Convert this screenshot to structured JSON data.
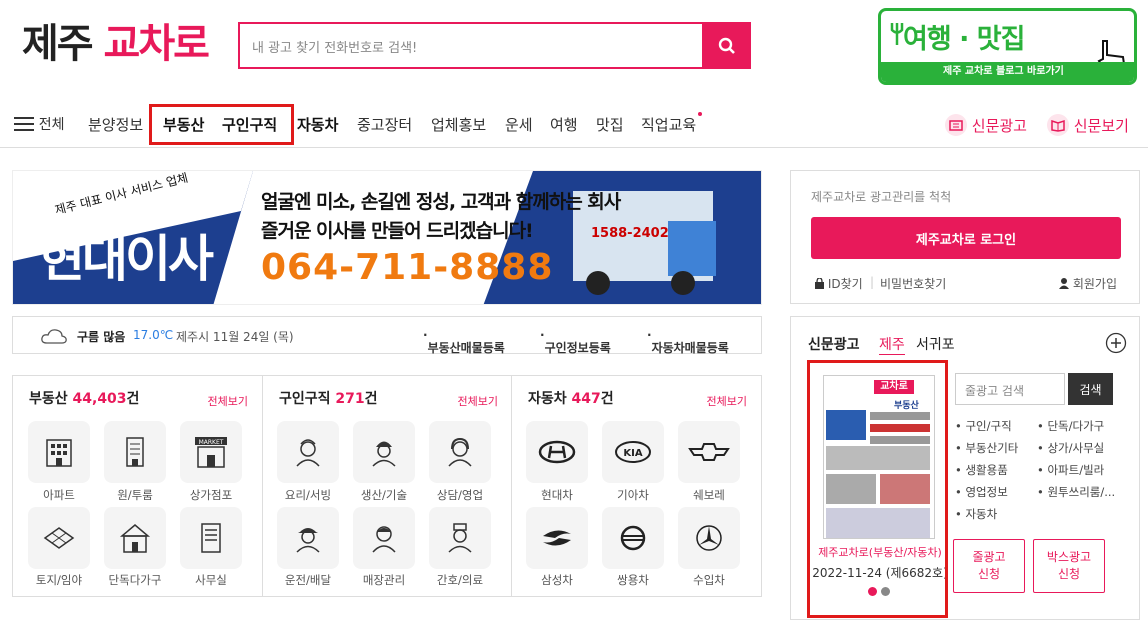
{
  "brand": {
    "logo_prefix": "제주",
    "logo_name": "교차로"
  },
  "search": {
    "placeholder": "내 광고 찾기 전화번호로 검색!"
  },
  "promo": {
    "title": "여행 · 맛집",
    "subtitle": "제주 교차로 블로그 바로가기"
  },
  "nav": {
    "menu_label": "전체",
    "items": [
      "분양정보",
      "부동산",
      "구인구직",
      "자동차",
      "중고장터",
      "업체홍보",
      "운세",
      "여행",
      "맛집",
      "직업교육"
    ],
    "right": [
      "신문광고",
      "신문보기"
    ]
  },
  "ad": {
    "tagline": "제주 대표 이사 서비스 업체",
    "company": "현대이사",
    "line1": "얼굴엔 미소, 손길엔 정성, 고객과 함께하는 회사",
    "line2": "즐거운 이사를 만들어 드리겠습니다!",
    "phone": "064-711-8888",
    "truck_phone": "1588-2402"
  },
  "weather": {
    "condition": "구름 많음",
    "temp": "17.0℃",
    "location": "제주시 11월 24일 (목)",
    "links": [
      "부동산매물등록",
      "구인정보등록",
      "자동차매물등록"
    ]
  },
  "categories": [
    {
      "title": "부동산",
      "count": "44,403",
      "unit": "건",
      "all": "전체보기",
      "items": [
        {
          "label": "아파트",
          "icon": "apartment-icon"
        },
        {
          "label": "원/투룸",
          "icon": "building-icon"
        },
        {
          "label": "상가점포",
          "icon": "market-icon"
        },
        {
          "label": "토지/임야",
          "icon": "land-icon"
        },
        {
          "label": "단독다가구",
          "icon": "house-icon"
        },
        {
          "label": "사무실",
          "icon": "office-icon"
        }
      ]
    },
    {
      "title": "구인구직",
      "count": "271",
      "unit": "건",
      "all": "전체보기",
      "items": [
        {
          "label": "요리/서빙",
          "icon": "cook-icon"
        },
        {
          "label": "생산/기술",
          "icon": "worker-icon"
        },
        {
          "label": "상담/영업",
          "icon": "agent-icon"
        },
        {
          "label": "운전/배달",
          "icon": "driver-icon"
        },
        {
          "label": "매장관리",
          "icon": "clerk-icon"
        },
        {
          "label": "간호/의료",
          "icon": "nurse-icon"
        }
      ]
    },
    {
      "title": "자동차",
      "count": "447",
      "unit": "건",
      "all": "전체보기",
      "items": [
        {
          "label": "현대차",
          "icon": "hyundai-icon"
        },
        {
          "label": "기아차",
          "icon": "kia-icon"
        },
        {
          "label": "쉐보레",
          "icon": "chevrolet-icon"
        },
        {
          "label": "삼성차",
          "icon": "samsung-icon"
        },
        {
          "label": "쌍용차",
          "icon": "ssangyong-icon"
        },
        {
          "label": "수입차",
          "icon": "mercedes-icon"
        }
      ]
    }
  ],
  "login": {
    "caption": "제주교차로 광고관리를 척척",
    "button": "제주교차로 로그인",
    "find_id": "ID찾기",
    "find_pw": "비밀번호찾기",
    "join": "회원가입"
  },
  "paper": {
    "tabs": [
      "신문광고",
      "제주",
      "서귀포"
    ],
    "search_placeholder": "줄광고 검색",
    "search_button": "검색",
    "links_left": [
      "구인/구직",
      "부동산기타",
      "생활용품",
      "영업정보",
      "자동차"
    ],
    "links_right": [
      "단독/다가구",
      "상가/사무실",
      "아파트/빌라",
      "원투쓰리룸/..."
    ],
    "edition_title": "제주교차로(부동산/자동차)",
    "edition_date": "2022-11-24 (제6682호)",
    "btn_line": "줄광고\n신청",
    "btn_box": "박스광고\n신청",
    "thumb_logo": "교차로",
    "thumb_section": "부동산"
  },
  "colors": {
    "accent": "#e8195a",
    "promo": "#2ab13a",
    "highlight": "#e01a1a"
  }
}
